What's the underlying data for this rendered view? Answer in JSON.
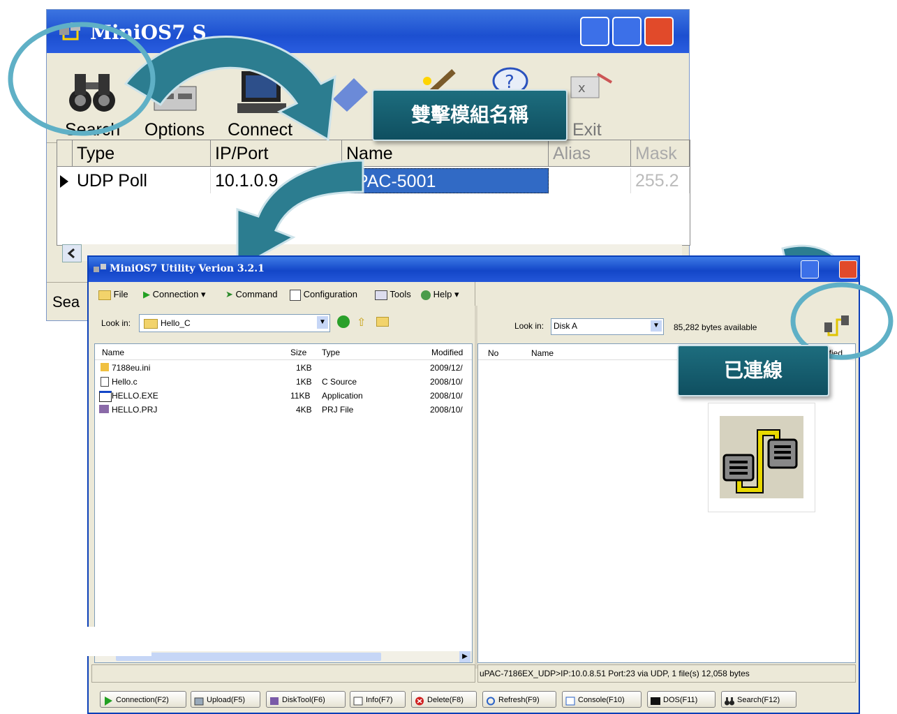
{
  "back_window": {
    "title": "MiniOS7 S",
    "toolbar": [
      "Search",
      "Options",
      "Connect",
      "Clear",
      "Exit"
    ],
    "grid": {
      "headers": [
        "Type",
        "IP/Port",
        "Name",
        "Alias",
        "Mask"
      ],
      "row": {
        "type": "UDP Poll",
        "ip": "10.1.0.9",
        "name": "uPAC-5001",
        "mask": "255.2"
      }
    },
    "status": "Sea"
  },
  "callouts": {
    "double_click": "雙擊模組名稱",
    "connected": "已連線"
  },
  "front_window": {
    "title": "MiniOS7 Utility Verion 3.2.1",
    "menu": [
      "File",
      "Connection",
      "Command",
      "Configuration",
      "Tools",
      "Help"
    ],
    "left": {
      "look_in_label": "Look in:",
      "look_in_value": "Hello_C",
      "headers": {
        "name": "Name",
        "size": "Size",
        "type": "Type",
        "modified": "Modified"
      },
      "files": [
        {
          "name": "7188eu.ini",
          "size": "1KB",
          "type": "",
          "modified": "2009/12/"
        },
        {
          "name": "Hello.c",
          "size": "1KB",
          "type": "C Source",
          "modified": "2008/10/"
        },
        {
          "name": "HELLO.EXE",
          "size": "11KB",
          "type": "Application",
          "modified": "2008/10/"
        },
        {
          "name": "HELLO.PRJ",
          "size": "4KB",
          "type": "PRJ File",
          "modified": "2008/10/"
        }
      ]
    },
    "right": {
      "look_in_label": "Look in:",
      "look_in_value": "Disk A",
      "available": "85,282 bytes available",
      "headers": {
        "no": "No",
        "name": "Name",
        "modified": "ified"
      }
    },
    "status_right": "uPAC-7186EX_UDP>IP:10.0.8.51 Port:23 via UDP, 1 file(s) 12,058 bytes",
    "buttons": [
      "Connection(F2)",
      "Upload(F5)",
      "DiskTool(F6)",
      "Info(F7)",
      "Delete(F8)",
      "Refresh(F9)",
      "Console(F10)",
      "DOS(F11)",
      "Search(F12)"
    ]
  },
  "colors": {
    "accent": "#1d6d7e",
    "title_blue": "#1346c8",
    "selection": "#316ac5"
  }
}
